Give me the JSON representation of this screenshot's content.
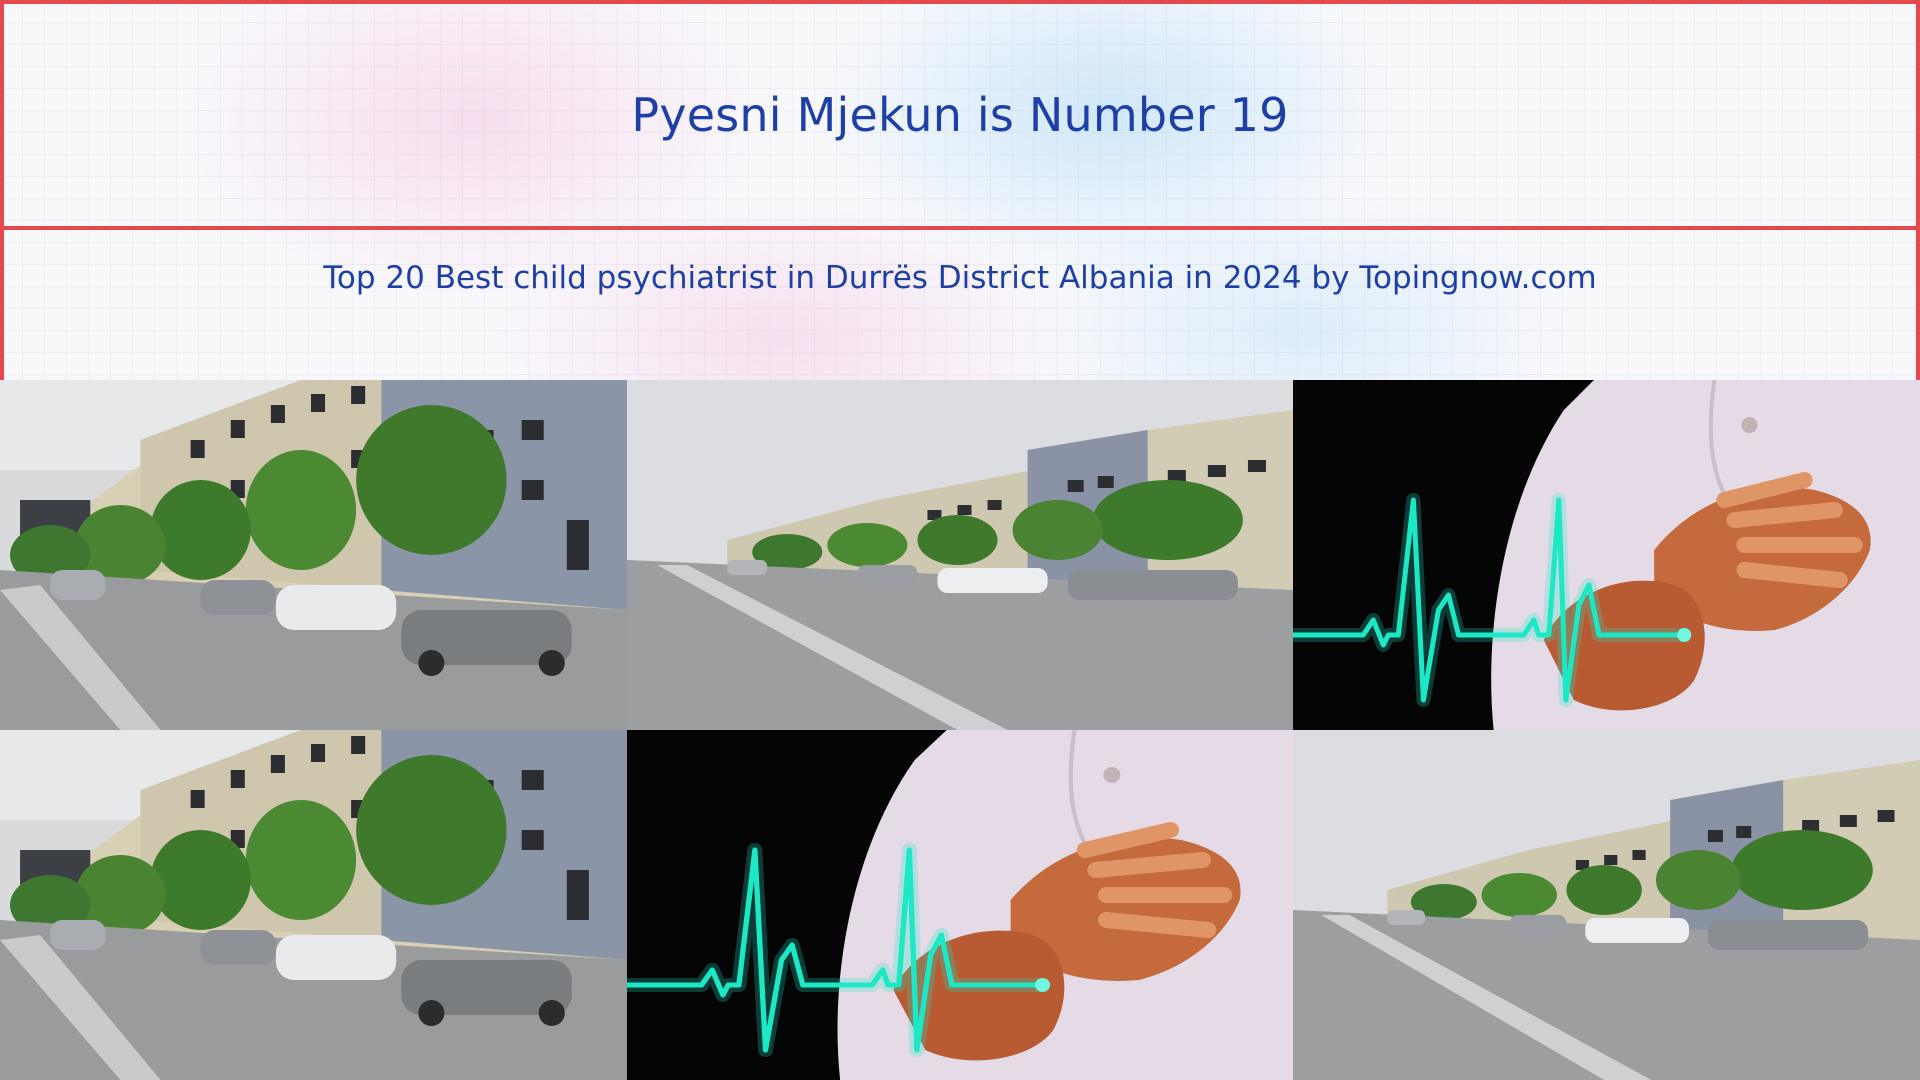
{
  "header": {
    "title": "Pyesni Mjekun is Number 19",
    "subtitle": "Top 20 Best child psychiatrist in Durrës District Albania in 2024 by Topingnow.com"
  },
  "gallery": {
    "images": [
      {
        "kind": "street-photo"
      },
      {
        "kind": "street-photo-wide"
      },
      {
        "kind": "heart-ecg-photo"
      },
      {
        "kind": "street-photo"
      },
      {
        "kind": "heart-ecg-photo"
      },
      {
        "kind": "street-photo-wide"
      }
    ]
  },
  "colors": {
    "title_text": "#1f3fa8",
    "frame_border": "#e5484d",
    "ecg_line": "#1de9c6"
  }
}
